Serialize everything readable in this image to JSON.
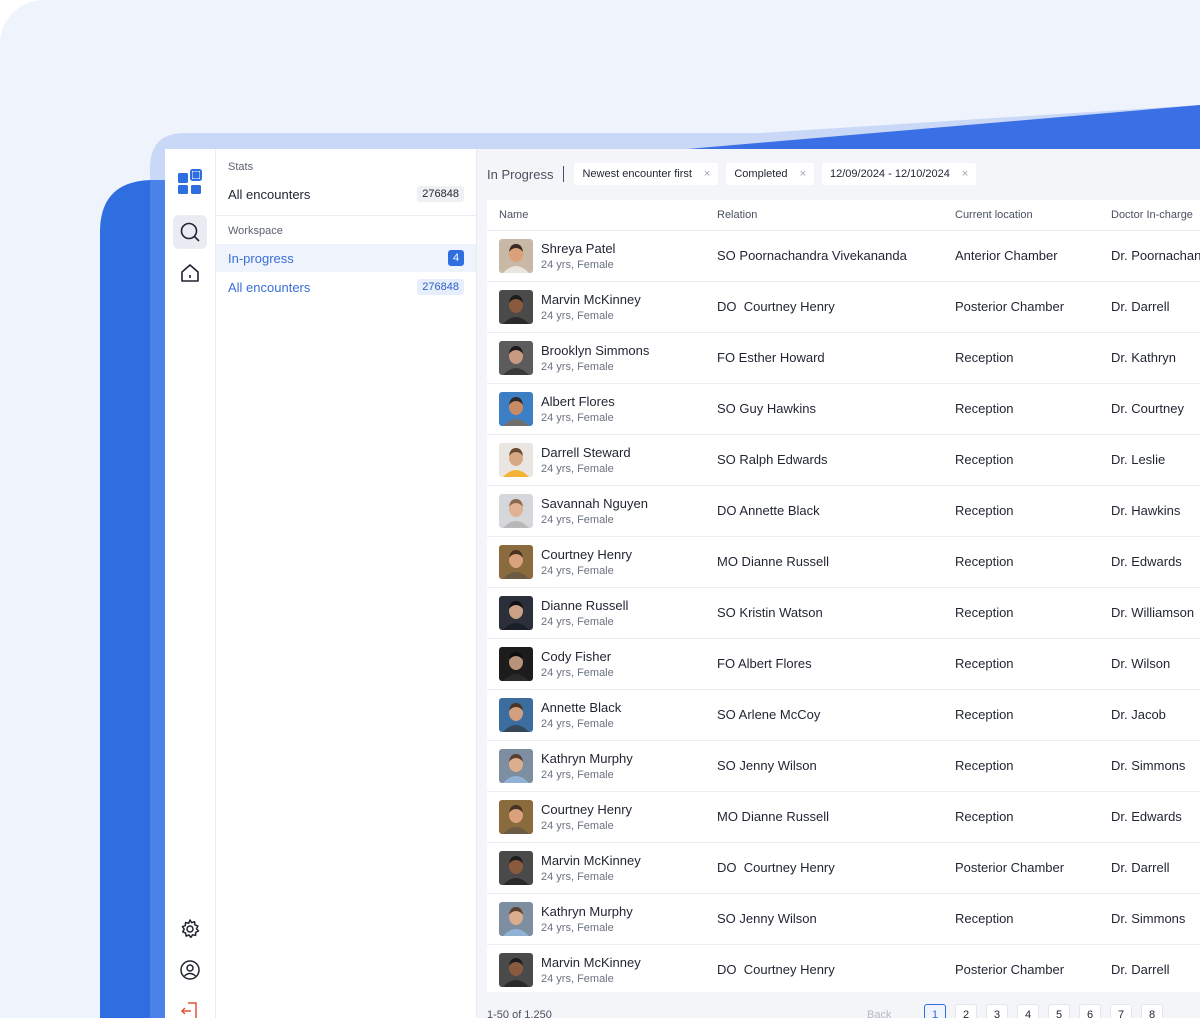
{
  "colors": {
    "accent": "#2f6ee0",
    "link": "#3a6fd8",
    "backdrop": "#eef3fc",
    "exit_icon": "#e0553a"
  },
  "rail": {
    "icons": [
      "apps-logo-icon",
      "search-icon",
      "home-icon",
      "gear-icon",
      "user-circle-icon",
      "logout-icon"
    ]
  },
  "sidebar": {
    "stats_label": "Stats",
    "stats_item": {
      "label": "All encounters",
      "count": "276848"
    },
    "workspace_label": "Workspace",
    "workspace_items": [
      {
        "label": "In-progress",
        "count": "4"
      },
      {
        "label": "All encounters",
        "count": "276848"
      }
    ]
  },
  "filters": {
    "title": "In Progress",
    "chips": [
      {
        "label": "Newest encounter first"
      },
      {
        "label": "Completed"
      },
      {
        "label": "12/09/2024 - 12/10/2024"
      }
    ],
    "remove_glyph": "×"
  },
  "table": {
    "columns": [
      "Name",
      "Relation",
      "Current location",
      "Doctor In-charge"
    ],
    "rows": [
      {
        "name": "Shreya Patel",
        "meta": "24 yrs, Female",
        "relation": "SO Poornachandra Vivekananda",
        "location": "Anterior Chamber",
        "doctor": "Dr. Poornachandra",
        "avatar": {
          "bg": "#c9b8a6",
          "skin": "#d9a07a",
          "hair": "#3a2a22",
          "shirt": "#e9e4dc"
        }
      },
      {
        "name": "Marvin McKinney",
        "meta": "24 yrs, Female",
        "relation": "DO  Courtney Henry",
        "location": "Posterior Chamber",
        "doctor": "Dr. Darrell",
        "avatar": {
          "bg": "#4a4a4a",
          "skin": "#8a5a3f",
          "hair": "#1d1d1d",
          "shirt": "#2a2a2a"
        }
      },
      {
        "name": "Brooklyn Simmons",
        "meta": "24 yrs, Female",
        "relation": "FO Esther Howard",
        "location": "Reception",
        "doctor": "Dr. Kathryn",
        "avatar": {
          "bg": "#5c5c5c",
          "skin": "#c89a80",
          "hair": "#1a1a1a",
          "shirt": "#3a3a3a"
        }
      },
      {
        "name": "Albert Flores",
        "meta": "24 yrs, Female",
        "relation": "SO Guy Hawkins",
        "location": "Reception",
        "doctor": "Dr. Courtney",
        "avatar": {
          "bg": "#3d7fc4",
          "skin": "#c98b63",
          "hair": "#2b2b2b",
          "shirt": "#6f6f6f"
        }
      },
      {
        "name": "Darrell Steward",
        "meta": "24 yrs, Female",
        "relation": "SO Ralph Edwards",
        "location": "Reception",
        "doctor": "Dr. Leslie",
        "avatar": {
          "bg": "#e9e6e2",
          "skin": "#d7a884",
          "hair": "#6b4a32",
          "shirt": "#f2b233"
        }
      },
      {
        "name": "Savannah Nguyen",
        "meta": "24 yrs, Female",
        "relation": "DO Annette Black",
        "location": "Reception",
        "doctor": "Dr. Hawkins",
        "avatar": {
          "bg": "#d5d7da",
          "skin": "#e0b294",
          "hair": "#8a6a4e",
          "shirt": "#b8b8b8"
        }
      },
      {
        "name": "Courtney Henry",
        "meta": "24 yrs, Female",
        "relation": "MO Dianne Russell",
        "location": "Reception",
        "doctor": "Dr. Edwards",
        "avatar": {
          "bg": "#8a6b3e",
          "skin": "#d9a27c",
          "hair": "#4a3222",
          "shirt": "#6b5a44"
        }
      },
      {
        "name": "Dianne Russell",
        "meta": "24 yrs, Female",
        "relation": "SO Kristin Watson",
        "location": "Reception",
        "doctor": "Dr. Williamson",
        "avatar": {
          "bg": "#2a2f3a",
          "skin": "#caa185",
          "hair": "#111111",
          "shirt": "#1b1f27"
        }
      },
      {
        "name": "Cody Fisher",
        "meta": "24 yrs, Female",
        "relation": "FO Albert Flores",
        "location": "Reception",
        "doctor": "Dr. Wilson",
        "avatar": {
          "bg": "#1c1c1c",
          "skin": "#b8927a",
          "hair": "#0e0e0e",
          "shirt": "#2a2a2a"
        }
      },
      {
        "name": "Annette Black",
        "meta": "24 yrs, Female",
        "relation": "SO Arlene McCoy",
        "location": "Reception",
        "doctor": "Dr. Jacob",
        "avatar": {
          "bg": "#3b6e9e",
          "skin": "#d2a07e",
          "hair": "#4a3524",
          "shirt": "#37475a"
        }
      },
      {
        "name": "Kathryn Murphy",
        "meta": "24 yrs, Female",
        "relation": "SO Jenny Wilson",
        "location": "Reception",
        "doctor": "Dr. Simmons",
        "avatar": {
          "bg": "#7c8ea0",
          "skin": "#dcae8e",
          "hair": "#5a4030",
          "shirt": "#8fb2d6"
        }
      },
      {
        "name": "Courtney Henry",
        "meta": "24 yrs, Female",
        "relation": "MO Dianne Russell",
        "location": "Reception",
        "doctor": "Dr. Edwards",
        "avatar": {
          "bg": "#8a6b3e",
          "skin": "#d9a27c",
          "hair": "#4a3222",
          "shirt": "#6b5a44"
        }
      },
      {
        "name": "Marvin McKinney",
        "meta": "24 yrs, Female",
        "relation": "DO  Courtney Henry",
        "location": "Posterior Chamber",
        "doctor": "Dr. Darrell",
        "avatar": {
          "bg": "#4a4a4a",
          "skin": "#8a5a3f",
          "hair": "#1d1d1d",
          "shirt": "#2a2a2a"
        }
      },
      {
        "name": "Kathryn Murphy",
        "meta": "24 yrs, Female",
        "relation": "SO Jenny Wilson",
        "location": "Reception",
        "doctor": "Dr. Simmons",
        "avatar": {
          "bg": "#7c8ea0",
          "skin": "#dcae8e",
          "hair": "#5a4030",
          "shirt": "#8fb2d6"
        }
      },
      {
        "name": "Marvin McKinney",
        "meta": "24 yrs, Female",
        "relation": "DO  Courtney Henry",
        "location": "Posterior Chamber",
        "doctor": "Dr. Darrell",
        "avatar": {
          "bg": "#4a4a4a",
          "skin": "#8a5a3f",
          "hair": "#1d1d1d",
          "shirt": "#2a2a2a"
        }
      }
    ]
  },
  "pagination": {
    "info": "1-50 of 1,250",
    "back_label": "Back",
    "pages": [
      "1",
      "2",
      "3",
      "4",
      "5",
      "6",
      "7",
      "8"
    ],
    "current": "1"
  }
}
